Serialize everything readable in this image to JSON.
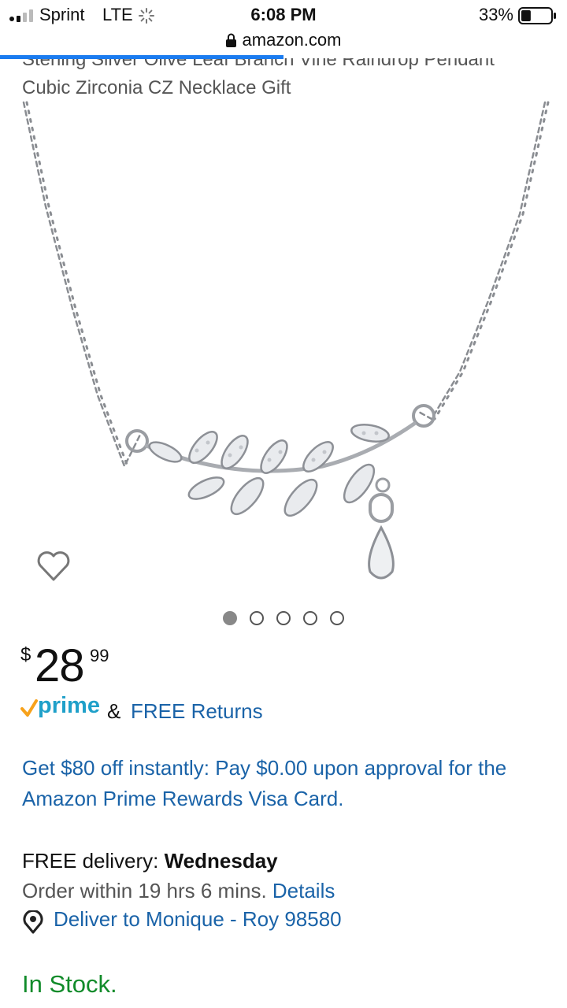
{
  "status_bar": {
    "carrier": "Sprint",
    "network": "LTE",
    "time": "6:08 PM",
    "battery_percent": "33%",
    "battery_level": 0.33
  },
  "browser": {
    "url": "amazon.com",
    "load_progress": 0.5
  },
  "product": {
    "title_line1": "Sterling Silver Olive Leaf Branch Vine Raindrop Pendant",
    "title_line2": "Cubic Zirconia CZ Necklace Gift",
    "image_count": 5,
    "active_image": 0
  },
  "price": {
    "currency": "$",
    "whole": "28",
    "fraction": "99"
  },
  "prime": {
    "word": "prime",
    "amp": "&",
    "returns": "FREE Returns"
  },
  "promo": {
    "text": "Get $80 off instantly: Pay $0.00 upon approval for the Amazon Prime Rewards Visa Card."
  },
  "delivery": {
    "label": "FREE delivery: ",
    "day": "Wednesday",
    "order_within": "Order within 19 hrs 6 mins. ",
    "details_link": "Details",
    "deliver_to": "Deliver to Monique - Roy 98580"
  },
  "availability": "In Stock.",
  "colors": {
    "link": "#1a63a8",
    "prime": "#1fa0c9",
    "in_stock": "#118b2a",
    "progress": "#1b7cf0"
  },
  "icons": [
    "signal-icon",
    "loading-icon",
    "battery-icon",
    "lock-icon",
    "heart-icon",
    "prime-check-icon",
    "location-pin-icon"
  ]
}
